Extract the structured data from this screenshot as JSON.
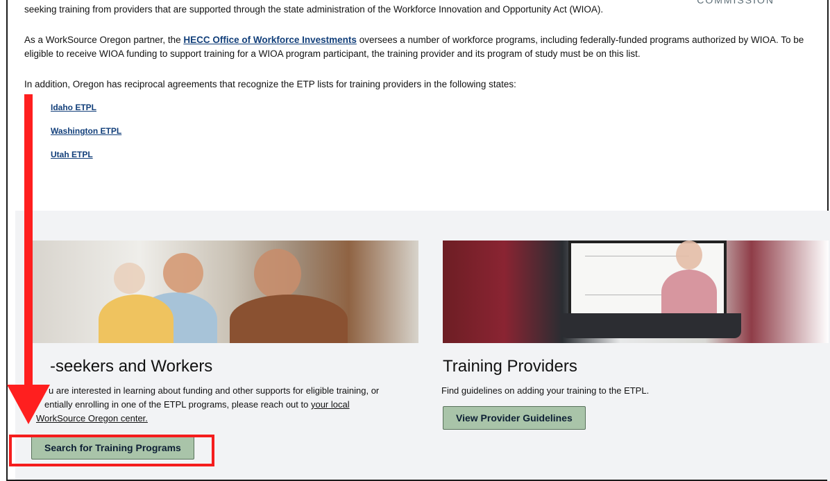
{
  "header": {
    "logo_fragment": "COMMISSION"
  },
  "intro": {
    "paragraph1": "seeking training from providers that are supported through the state administration of the Workforce Innovation and Opportunity Act (WIOA).",
    "paragraph2_before": "As a WorkSource Oregon partner, the ",
    "paragraph2_link": "HECC Office of Workforce Investments",
    "paragraph2_after": " oversees a number of workforce programs, including federally-funded programs authorized by WIOA. To be eligible to receive WIOA funding to support training for a WIOA program participant, the training provider and its program of study must be on this list.",
    "paragraph3": "In addition, Oregon has reciprocal agreements that recognize the ETP lists for training providers in the following states:"
  },
  "state_links": [
    {
      "label": "Idaho ETPL"
    },
    {
      "label": "Washington ETPL"
    },
    {
      "label": "Utah ETPL"
    }
  ],
  "left_card": {
    "title_visible": "-seekers and Workers",
    "text_line1": "u are interested in learning about funding and other supports for eligible training, or",
    "text_line2_before": "entially enrolling in one of the ETPL programs, please reach out to ",
    "text_line2_link": "your local",
    "text_line3": "WorkSource Oregon center.",
    "button_label": "Search for Training Programs"
  },
  "right_card": {
    "title": "Training Providers",
    "text": "Find guidelines on adding your training to the ETPL.",
    "button_label": "View Provider Guidelines"
  },
  "annotation": {
    "arrow_color": "#ff1f1f",
    "box_color": "#f51d1d"
  }
}
